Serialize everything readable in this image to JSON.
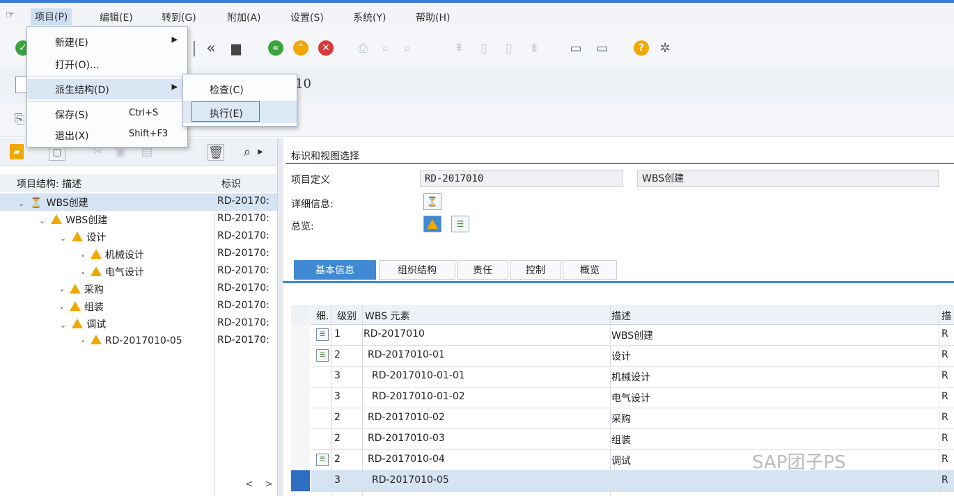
{
  "menubar": {
    "items": [
      "项目(P)",
      "编辑(E)",
      "转到(G)",
      "附加(A)",
      "设置(S)",
      "系统(Y)",
      "帮助(H)"
    ]
  },
  "toolbar": {
    "icons": [
      "check-icon",
      "back-icon",
      "save-icon",
      "green-back-icon",
      "exit-icon",
      "cancel-icon",
      "print-icon",
      "find-icon",
      "find-next-icon",
      "first-page-icon",
      "prev-page-icon",
      "next-page-icon",
      "last-page-icon",
      "new-window-icon",
      "shortcut-icon",
      "help-icon",
      "settings-icon"
    ]
  },
  "command_field": {
    "value": "10"
  },
  "dropdown": {
    "items": [
      {
        "label": "新建(E)",
        "shortcut": "",
        "arrow": "▶"
      },
      {
        "label": "打开(O)...",
        "shortcut": "",
        "arrow": ""
      },
      {
        "label": "派生结构(D)",
        "shortcut": "",
        "arrow": "▶"
      },
      {
        "label": "保存(S)",
        "shortcut": "Ctrl+S",
        "arrow": ""
      },
      {
        "label": "退出(X)",
        "shortcut": "Shift+F3",
        "arrow": ""
      }
    ]
  },
  "submenu": {
    "items": [
      "检查(C)",
      "执行(E)"
    ]
  },
  "tree": {
    "header_desc": "项目结构: 描述",
    "header_id": "标识",
    "rows": [
      {
        "label": "WBS创建",
        "id": "RD-20170:"
      },
      {
        "label": "WBS创建",
        "id": "RD-20170:"
      },
      {
        "label": "设计",
        "id": "RD-20170:"
      },
      {
        "label": "机械设计",
        "id": "RD-20170:"
      },
      {
        "label": "电气设计",
        "id": "RD-20170:"
      },
      {
        "label": "采购",
        "id": "RD-20170:"
      },
      {
        "label": "组装",
        "id": "RD-20170:"
      },
      {
        "label": "调试",
        "id": "RD-20170:"
      },
      {
        "label": "RD-2017010-05",
        "id": "RD-20170:"
      }
    ],
    "scroll_arrows": "< >"
  },
  "identification": {
    "section_title": "标识和视图选择",
    "project_def_label": "项目定义",
    "project_def_value": "RD-2017010",
    "project_desc_value": "WBS创建",
    "detail_label": "详细信息:",
    "overview_label": "总览:"
  },
  "tabs": [
    "基本信息",
    "组织结构",
    "责任",
    "控制",
    "概览"
  ],
  "grid": {
    "headers": {
      "detail": "细.",
      "level": "级别",
      "wbs": "WBS 元素",
      "desc": "描述",
      "extra": "描"
    },
    "rows": [
      {
        "level": "1",
        "wbs": "RD-2017010",
        "desc": "WBS创建",
        "extra": "R",
        "detail": "☰"
      },
      {
        "level": "2",
        "wbs": "RD-2017010-01",
        "desc": "设计",
        "extra": "R",
        "detail": "☰"
      },
      {
        "level": "3",
        "wbs": "RD-2017010-01-01",
        "desc": "机械设计",
        "extra": "R",
        "detail": ""
      },
      {
        "level": "3",
        "wbs": "RD-2017010-01-02",
        "desc": "电气设计",
        "extra": "R",
        "detail": ""
      },
      {
        "level": "2",
        "wbs": "RD-2017010-02",
        "desc": "采购",
        "extra": "R",
        "detail": ""
      },
      {
        "level": "2",
        "wbs": "RD-2017010-03",
        "desc": "组装",
        "extra": "R",
        "detail": ""
      },
      {
        "level": "2",
        "wbs": "RD-2017010-04",
        "desc": "调试",
        "extra": "R",
        "detail": "☰"
      },
      {
        "level": "3",
        "wbs": "RD-2017010-05",
        "desc": "",
        "extra": "R",
        "detail": ""
      }
    ]
  },
  "watermark": "SAP团子PS",
  "colors": {
    "accent": "#3f8ad3",
    "selection": "#d5e3f2",
    "highlight_box": "#d8495d",
    "wbs_icon": "#f0a800"
  }
}
